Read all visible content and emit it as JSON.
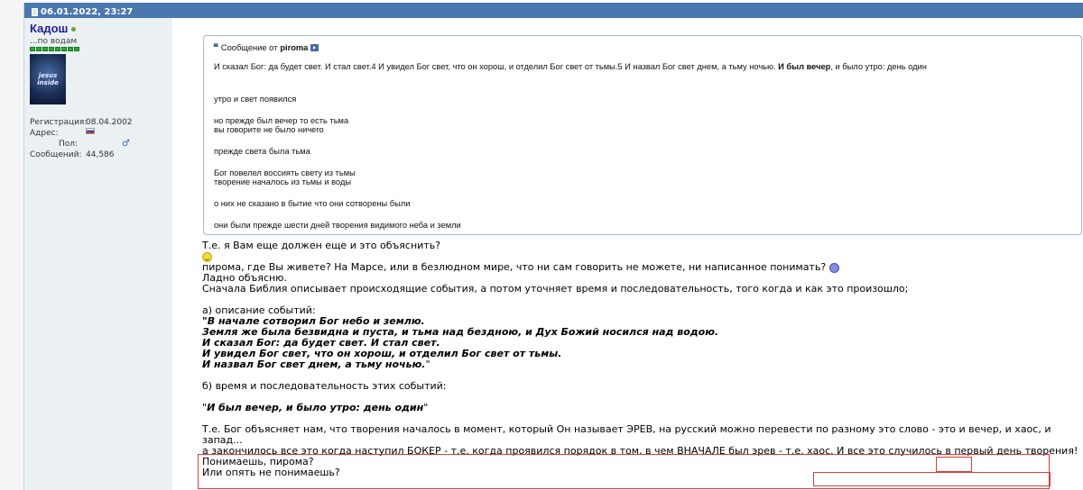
{
  "post": {
    "timestamp": "06.01.2022, 23:27"
  },
  "user": {
    "name": "Кадош",
    "title": "...по водам",
    "avatar_text": "jesus inside",
    "reg_label": "Регистрация:",
    "reg_value": "08.04.2002",
    "address_label": "Адрес:",
    "gender_label": "Пол:",
    "posts_label": "Сообщений:",
    "posts_value": "44,586",
    "icons": {
      "online": "online-dot-icon",
      "flag": "flag-icon",
      "gender": "male-gender-icon"
    }
  },
  "quote": {
    "prefix": "Сообщение от",
    "author": "piroma",
    "line1_pre": "И сказал Бог: да будет свет. И стал свет.4 И увидел Бог свет, что он хорош, и отделил Бог свет от тьмы.5 И назвал Бог свет днем, а тьму ночью. ",
    "line1_bold": "И был вечер",
    "line1_post": ", и было утро: день один",
    "lines": [
      "утро и свет появился",
      "но прежде был вечер то есть тьма",
      "вы говорите не было ничего",
      "прежде света была тьма",
      "Бог повелел воссиять свету из тьмы",
      "творение началось из тьмы и воды",
      "о них не сказано в бытие что они сотворены были",
      "они были прежде шести дней творения видимого неба и земли"
    ]
  },
  "message": {
    "p1": "Т.е. я Вам еще должен еще и это объяснить?",
    "p2": "пирома, где Вы живете? На Марсе, или в безлюдном мире, что ни сам говорить не можете, ни написанное понимать?",
    "p3": "Ладно объясню.",
    "p4": "Сначала Библия описывает происходящие события, а потом уточняет время и последовательность, того когда и как это произошло;",
    "a_label": "а) описание событий:",
    "a_quote_open": "\"",
    "a1": "В начале сотворил Бог небо и землю.",
    "a2": "Земля же была безвидна и пуста, и тьма над бездною, и Дух Божий носился над водою.",
    "a3": "И сказал Бог: да будет свет. И стал свет.",
    "a4": "И увидел Бог свет, что он хорош, и отделил Бог свет от тьмы.",
    "a5": "И назвал Бог свет днем, а тьму ночью.",
    "a_quote_close": "\"",
    "b_label": "б) время и последовательность этих событий:",
    "b_quote_open": "\"",
    "b_text": "И был вечер, и было утро: день один",
    "b_quote_close": "\"",
    "c1_pre": "Т.е. Бог объясняет нам, что творения началось в момент, который Он называет ЭРЕВ, на русский можно перевести по разному это слово - это и ",
    "c1_word": "вечер",
    "c1_post": ", и хаос, и запад...",
    "c2_pre": "а закончилось все это когда наступил БОКЕР - т.е. когда проявился порядок в том, в чем ВНАЧАЛЕ был эрев - т.е. хаос. ",
    "c2_hl": "И все это случилось в первый день творения!",
    "c3": "Понимаешь, пирома?",
    "c4": "Или опять не понимаешь?"
  },
  "colors": {
    "header_bg": "#4a77ad",
    "username": "#22229c",
    "sidebar_bg": "#ebf0f3",
    "quote_border": "#9fb8d0",
    "highlight_border": "#e13a3a"
  }
}
